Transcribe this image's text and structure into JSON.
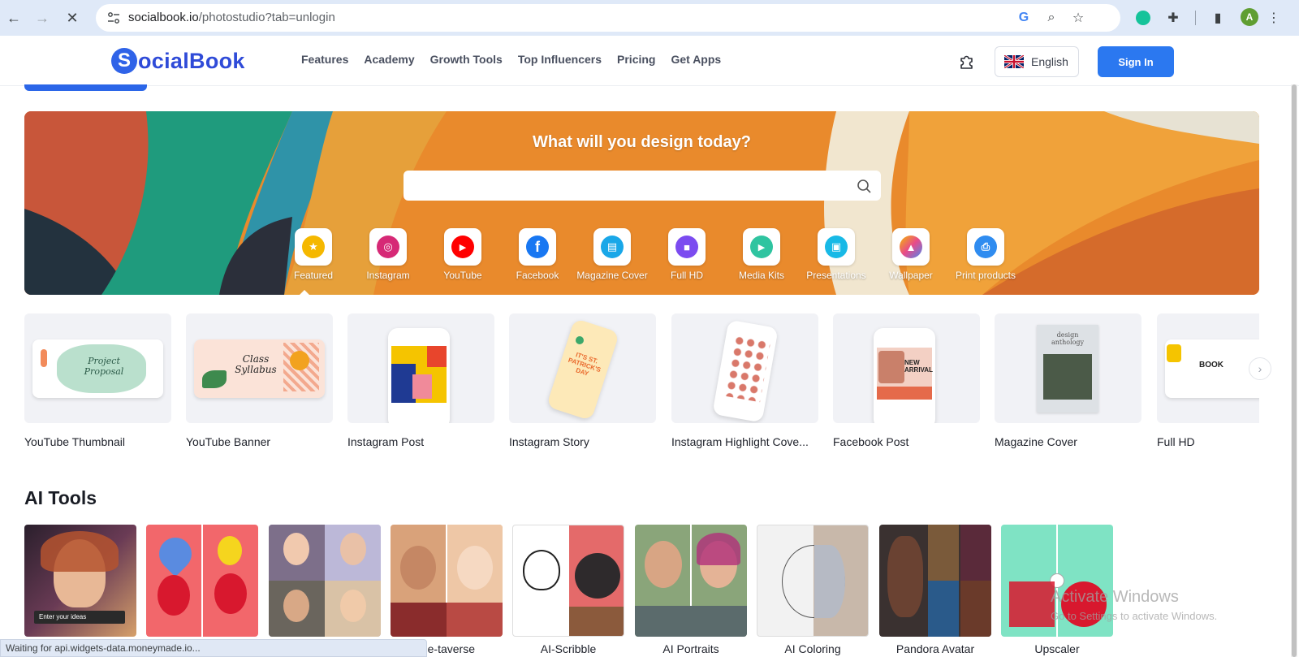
{
  "browser": {
    "url_host": "socialbook.io",
    "url_path": "/photostudio?tab=unlogin",
    "avatar_letter": "A",
    "status_text": "Waiting for api.widgets-data.moneymade.io..."
  },
  "header": {
    "logo_letter": "S",
    "logo_text": "ocialBook",
    "nav": [
      "Features",
      "Academy",
      "Growth Tools",
      "Top Influencers",
      "Pricing",
      "Get Apps"
    ],
    "language": "English",
    "sign_in": "Sign In"
  },
  "hero": {
    "title": "What will you design today?",
    "search_placeholder": "",
    "categories": [
      {
        "label": "Featured",
        "icon": "star-icon",
        "color": "#f5b800",
        "glyph": "★"
      },
      {
        "label": "Instagram",
        "icon": "instagram-icon",
        "color": "#d62976",
        "glyph": "◎"
      },
      {
        "label": "YouTube",
        "icon": "youtube-icon",
        "color": "#ff0000",
        "glyph": "▶"
      },
      {
        "label": "Facebook",
        "icon": "facebook-icon",
        "color": "#1877f2",
        "glyph": "f"
      },
      {
        "label": "Magazine Cover",
        "icon": "magazine-icon",
        "color": "#19a7e8",
        "glyph": "▤"
      },
      {
        "label": "Full HD",
        "icon": "video-icon",
        "color": "#7b4bf0",
        "glyph": "■"
      },
      {
        "label": "Media Kits",
        "icon": "media-kit-icon",
        "color": "#2fc4a0",
        "glyph": "▶"
      },
      {
        "label": "Presentations",
        "icon": "presentation-icon",
        "color": "#18b9e6",
        "glyph": "▣"
      },
      {
        "label": "Wallpaper",
        "icon": "wallpaper-icon",
        "color": "#f27a3a",
        "glyph": "▲"
      },
      {
        "label": "Print products",
        "icon": "printer-icon",
        "color": "#2f8cf0",
        "glyph": "⎙"
      }
    ]
  },
  "templates": [
    {
      "name": "YouTube Thumbnail",
      "mock_text": "Project Proposal"
    },
    {
      "name": "YouTube Banner",
      "mock_text": "Class Syllabus"
    },
    {
      "name": "Instagram Post",
      "mock_text": ""
    },
    {
      "name": "Instagram Story",
      "mock_text": "IT'S ST. PATRICK'S DAY"
    },
    {
      "name": "Instagram Highlight Cove...",
      "mock_text": ""
    },
    {
      "name": "Facebook Post",
      "mock_text": "NEW ARRIVAL"
    },
    {
      "name": "Magazine Cover",
      "mock_text": "design anthology"
    },
    {
      "name": "Full HD",
      "mock_text": "BOOK"
    }
  ],
  "ai_tools": {
    "title": "AI Tools",
    "enter_ideas": "Enter your ideas",
    "items": [
      {
        "name": "",
        "bg": "#3b2d3a"
      },
      {
        "name": "",
        "bg": "#f2676b"
      },
      {
        "name": "",
        "bg": "#a7a6c9"
      },
      {
        "name": "Me-taverse",
        "bg": "#d9a27a"
      },
      {
        "name": "AI-Scribble",
        "bg": "#ffffff"
      },
      {
        "name": "AI Portraits",
        "bg": "#8aa57a"
      },
      {
        "name": "AI Coloring",
        "bg": "#dcd6cf"
      },
      {
        "name": "Pandora Avatar",
        "bg": "#3a3130"
      },
      {
        "name": "Upscaler",
        "bg": "#7fe3c4"
      }
    ]
  },
  "watermark": {
    "line1": "Activate Windows",
    "line2": "Go to Settings to activate Windows."
  }
}
